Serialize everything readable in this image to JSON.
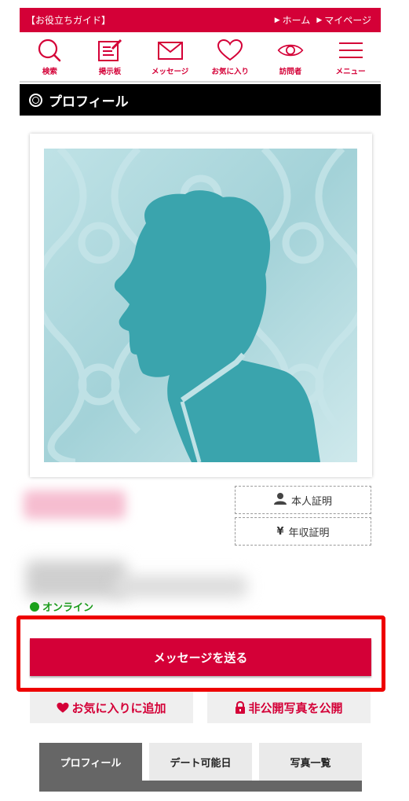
{
  "header": {
    "guide_label": "【お役立ちガイド】",
    "home_label": "ホーム",
    "mypage_label": "マイページ",
    "arrow_glyph": "▶"
  },
  "nav": {
    "items": [
      {
        "label": "検索",
        "icon": "search-icon"
      },
      {
        "label": "掲示板",
        "icon": "board-icon"
      },
      {
        "label": "メッセージ",
        "icon": "mail-icon"
      },
      {
        "label": "お気に入り",
        "icon": "heart-icon"
      },
      {
        "label": "訪問者",
        "icon": "eye-icon"
      },
      {
        "label": "メニュー",
        "icon": "menu-icon"
      }
    ]
  },
  "section": {
    "title": "プロフィール"
  },
  "certs": {
    "identity_label": "本人証明",
    "income_label": "年収証明",
    "income_symbol": "¥"
  },
  "status": {
    "online_label": "オンライン"
  },
  "actions": {
    "send_message_label": "メッセージを送る",
    "add_favorite_label": "お気に入りに追加",
    "publish_private_label": "非公開写真を公開"
  },
  "tabs": [
    {
      "label": "プロフィール",
      "active": true
    },
    {
      "label": "デート可能日",
      "active": false
    },
    {
      "label": "写真一覧",
      "active": false
    }
  ],
  "colors": {
    "brand": "#d40037",
    "online": "#1aa01a",
    "highlight": "#ee0000",
    "placeholder_bg": "#aed7dc",
    "silhouette": "#3aa4ad"
  }
}
